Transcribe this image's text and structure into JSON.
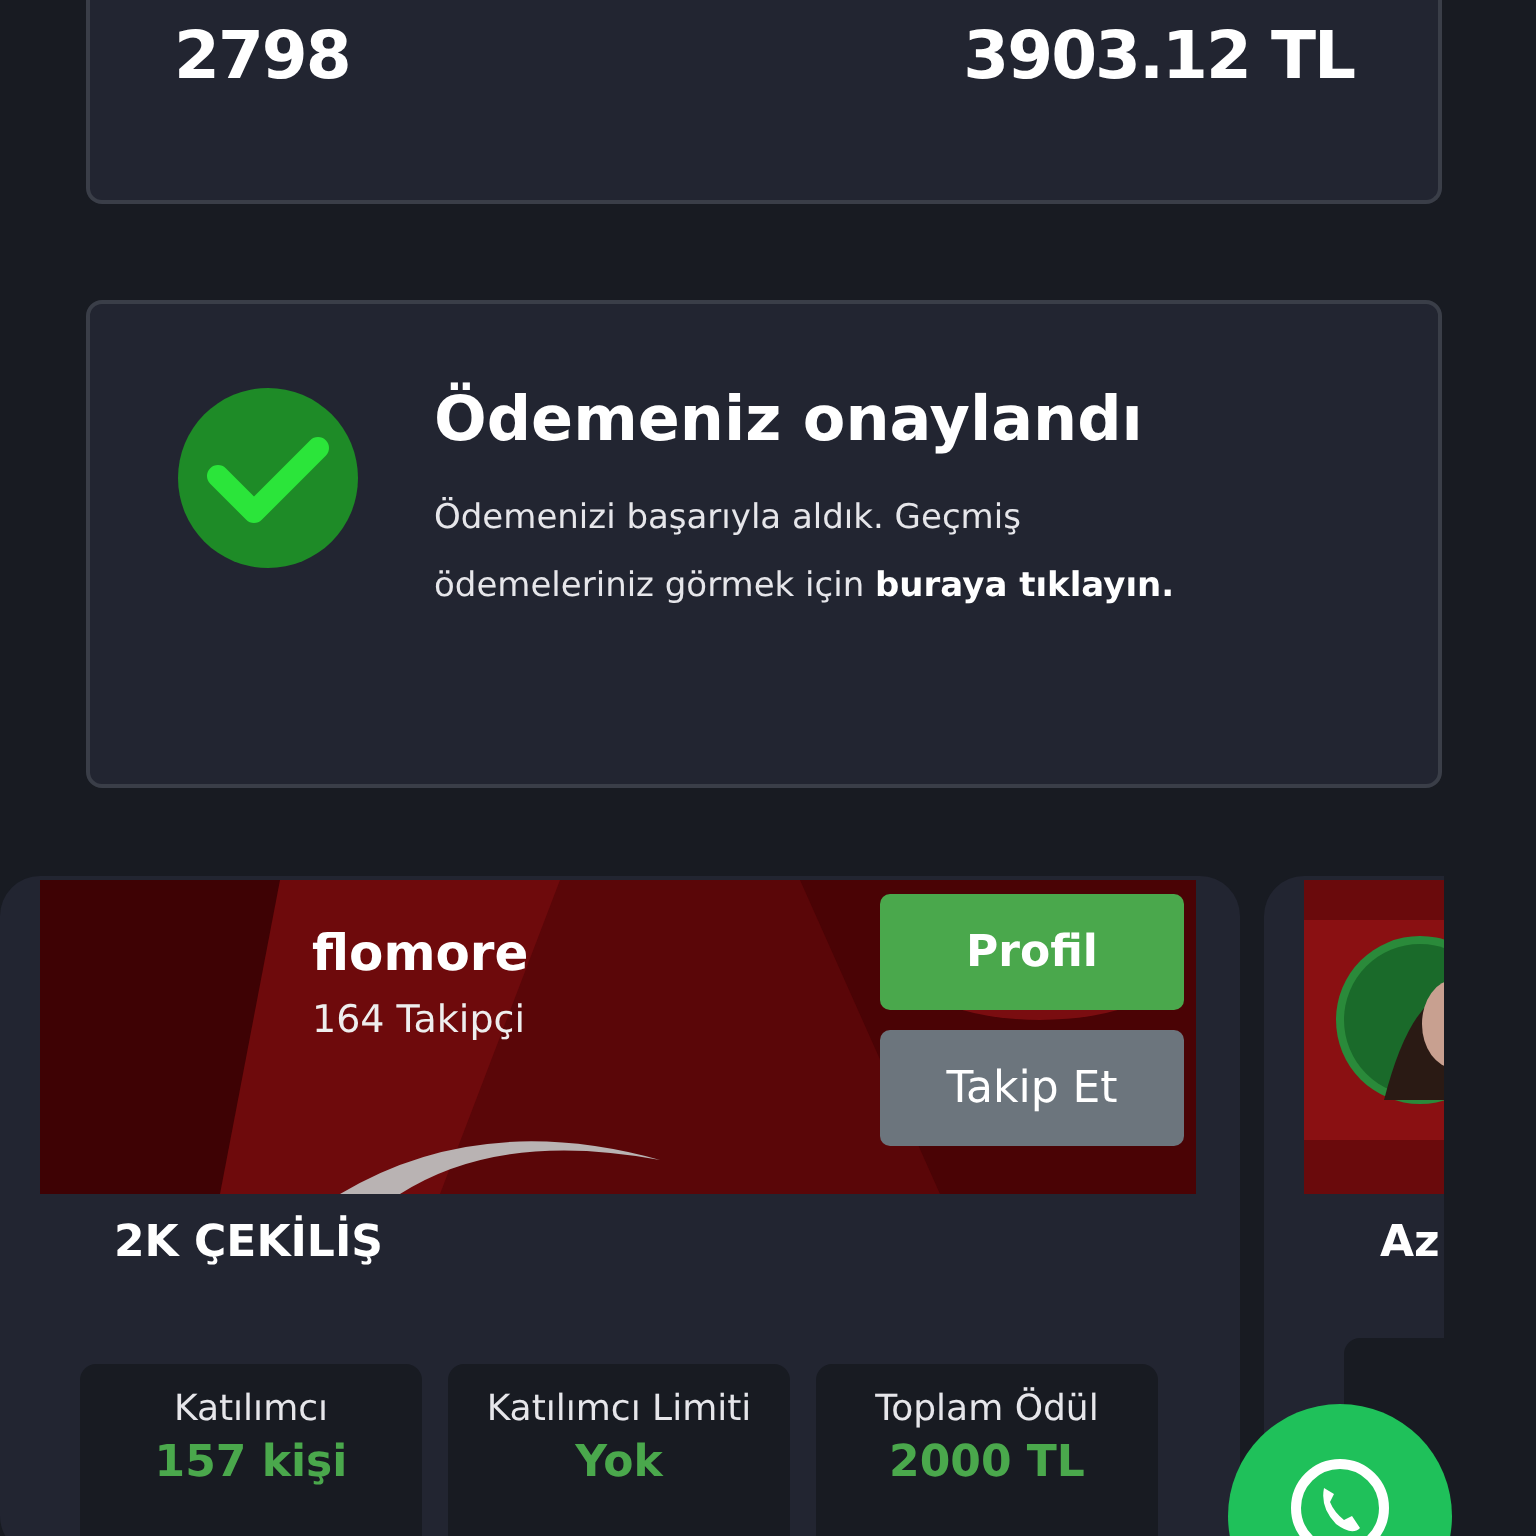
{
  "summary": {
    "count": "2798",
    "amount": "3903.12 TL"
  },
  "notice": {
    "title": "Ödemeniz onaylandı",
    "message": "Ödemenizi başarıyla aldık. Geçmiş ödemeleriniz görmek için",
    "link": "buraya tıklayın."
  },
  "giveaways": [
    {
      "user": "flomore",
      "followers": "164 Takipçi",
      "profile_button": "Profil",
      "follow_button": "Takip Et",
      "title": "2K ÇEKİLİŞ",
      "stats": [
        {
          "label": "Katılımcı",
          "value": "157 kişi"
        },
        {
          "label": "Katılımcı Limiti",
          "value": "Yok"
        },
        {
          "label": "Toplam Ödül",
          "value": "2000 TL"
        }
      ]
    },
    {
      "title": "Az",
      "stats": [
        {
          "kind": "cut"
        }
      ]
    }
  ],
  "whatsapp_button": {
    "kind": "chat"
  }
}
